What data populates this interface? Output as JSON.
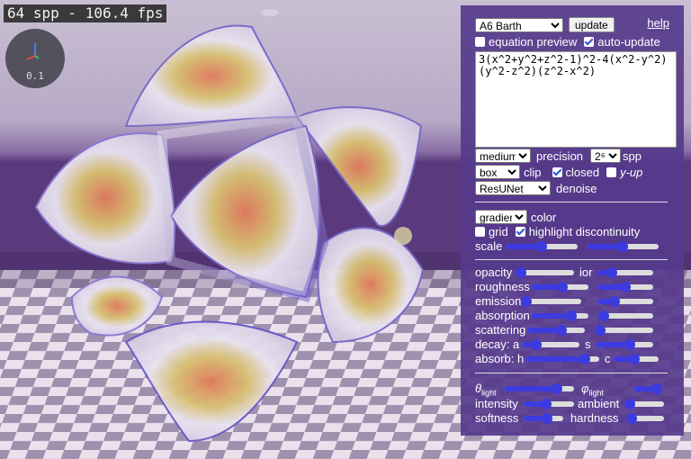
{
  "viewport": {
    "stats": "64 spp - 106.4 fps",
    "gizmo_scale": "0.1"
  },
  "panel": {
    "preset": "A6 Barth",
    "update_label": "update",
    "help_label": "help",
    "equation_preview_label": "equation preview",
    "equation_preview_checked": false,
    "auto_update_label": "auto-update",
    "auto_update_checked": true,
    "equation": "3(x^2+y^2+z^2-1)^2-4(x^2-y^2)(y^2-z^2)(z^2-x^2)",
    "precision_value": "medium",
    "precision_label": "precision",
    "spp_value": "2⁶",
    "spp_label": "spp",
    "clip_value": "box",
    "clip_label": "clip",
    "closed_label": "closed",
    "closed_checked": true,
    "yup_label": "y-up",
    "yup_checked": false,
    "denoise_value": "ResUNet",
    "denoise_label": "denoise",
    "color_value": "gradient",
    "color_label": "color",
    "grid_label": "grid",
    "grid_checked": false,
    "highlight_label": "highlight discontinuity",
    "highlight_checked": true,
    "scale_label": "scale",
    "scale_values": [
      0.5,
      0.5
    ],
    "sliders": [
      {
        "label": "opacity",
        "value": 0.05,
        "label2": "ior",
        "value2": 0.25
      },
      {
        "label": "roughness",
        "value": 0.55,
        "label2": "",
        "value2": 0.5
      },
      {
        "label": "emission",
        "value": 0.05,
        "label2": "",
        "value2": 0.3
      },
      {
        "label": "absorption",
        "value": 0.7,
        "label2": "",
        "value2": 0.12
      },
      {
        "label": "scattering",
        "value": 0.6,
        "label2": "",
        "value2": 0.05
      },
      {
        "label": "decay: a",
        "value": 0.25,
        "label2": "s",
        "value2": 0.6
      },
      {
        "label": "absorb: h",
        "value": 0.8,
        "label2": "c",
        "value2": 0.45
      }
    ],
    "light": [
      {
        "label": "θ",
        "sub": "light",
        "value": 0.75,
        "label2": "φ",
        "sub2": "light",
        "value2": 0.85
      },
      {
        "label": "intensity",
        "value": 0.45,
        "label2": "ambient",
        "value2": 0.05
      },
      {
        "label": "softness",
        "value": 0.6,
        "label2": "hardness",
        "value2": 0.05
      }
    ]
  }
}
